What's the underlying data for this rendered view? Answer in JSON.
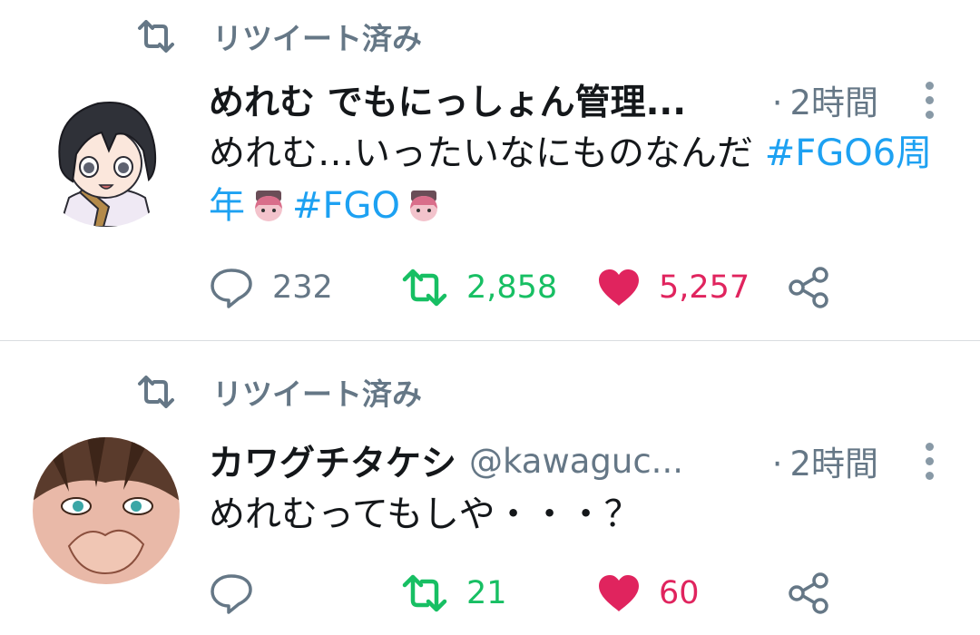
{
  "retweet_label": "リツイート済み",
  "tweets": [
    {
      "author_name": "めれむ でもにっしょん管理...",
      "handle": "",
      "time": "2時間",
      "text_plain": "めれむ…いったいなにものなんだ ",
      "hashtags": [
        "#FGO6周年",
        "#FGO"
      ],
      "reply_count": "232",
      "retweet_count": "2,858",
      "like_count": "5,257"
    },
    {
      "author_name": "カワグチタケシ",
      "handle": "@kawaguc...",
      "time": "2時間",
      "text_plain": "めれむってもしや・・・？",
      "reply_count": "",
      "retweet_count": "21",
      "like_count": "60"
    }
  ],
  "separator_dot": "·",
  "colors": {
    "retweeted": "#17bf63",
    "liked": "#e0245e",
    "hashtag": "#1da1f2",
    "secondary_text": "#657786"
  },
  "icons": [
    "retweet-icon",
    "reply-icon",
    "heart-icon",
    "share-icon",
    "more-vert-icon"
  ]
}
